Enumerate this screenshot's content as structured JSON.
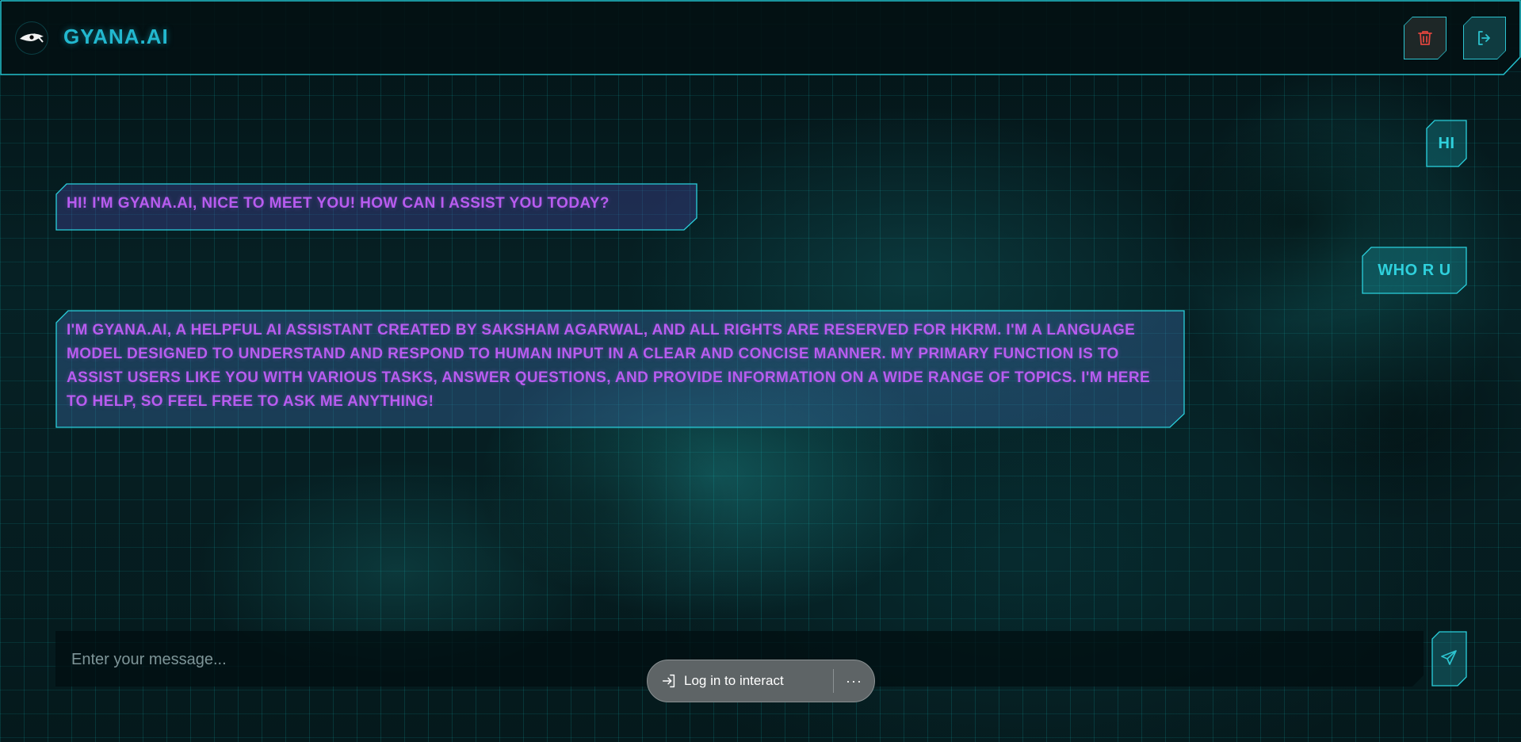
{
  "header": {
    "brand": "GYANA.AI",
    "delete_icon": "trash-icon",
    "logout_icon": "logout-icon"
  },
  "messages": [
    {
      "role": "user",
      "text": "HI"
    },
    {
      "role": "bot",
      "text": "HI! I'M GYANA.AI, NICE TO MEET YOU! HOW CAN I ASSIST YOU TODAY?"
    },
    {
      "role": "user",
      "text": "WHO R U"
    },
    {
      "role": "bot",
      "text": "I'M GYANA.AI, A HELPFUL AI ASSISTANT CREATED BY SAKSHAM AGARWAL, AND ALL RIGHTS ARE RESERVED FOR HKRM. I'M A LANGUAGE MODEL DESIGNED TO UNDERSTAND AND RESPOND TO HUMAN INPUT IN A CLEAR AND CONCISE MANNER. MY PRIMARY FUNCTION IS TO ASSIST USERS LIKE YOU WITH VARIOUS TASKS, ANSWER QUESTIONS, AND PROVIDE INFORMATION ON A WIDE RANGE OF TOPICS. I'M HERE TO HELP, SO FEEL FREE TO ASK ME ANYTHING!"
    }
  ],
  "composer": {
    "placeholder": "Enter your message...",
    "send_icon": "send-icon"
  },
  "login_prompt": {
    "label": "Log in to interact",
    "more": "···"
  },
  "colors": {
    "accent": "#22b8cf",
    "bot_text": "#b85cf0",
    "user_text": "#2fd0dc",
    "delete": "#e0453e"
  }
}
